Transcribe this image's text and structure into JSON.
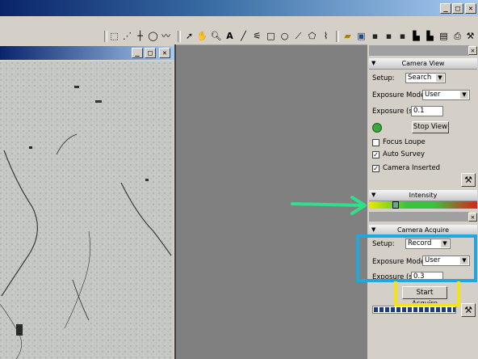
{
  "toolbar": {
    "icons": [
      "marquee-select-icon",
      "line-select-icon",
      "crosshair-icon",
      "lasso-icon",
      "freehand-icon",
      "arrow-pointer-icon",
      "hand-pan-icon",
      "zoom-icon",
      "text-tool-icon",
      "line-tool-icon",
      "wand-icon",
      "rectangle-tool-icon",
      "oval-tool-icon",
      "eyedropper-icon",
      "polygon-tool-icon",
      "script-icon",
      "open-folder-icon",
      "new-image-icon",
      "save-icon",
      "save-as-icon",
      "save-all-icon",
      "histogram-icon",
      "profile-icon",
      "stats-icon",
      "print-icon",
      "tools-icon"
    ]
  },
  "camera_view": {
    "title": "Camera View",
    "setup_label": "Setup:",
    "setup_value": "Search",
    "exposure_mode_label": "Exposure Mode:",
    "exposure_mode_value": "User",
    "exposure_label": "Exposure (s)",
    "exposure_value": "0.1",
    "stop_view_label": "Stop View",
    "focus_loupe_label": "Focus Loupe",
    "focus_loupe_checked": false,
    "auto_survey_label": "Auto Survey",
    "auto_survey_checked": true,
    "camera_inserted_label": "Camera Inserted",
    "camera_inserted_checked": true
  },
  "intensity": {
    "title": "Intensity",
    "level": 0.22
  },
  "camera_acquire": {
    "title": "Camera Acquire",
    "setup_label": "Setup:",
    "setup_value": "Record",
    "exposure_mode_label": "Exposure Mode:",
    "exposure_mode_value": "User",
    "exposure_label": "Exposure (s)",
    "exposure_value": "0.3",
    "start_acquire_label": "Start Acquire"
  },
  "colors": {
    "annotation_green": "#2ee08a",
    "annotation_blue": "#1fa8e0",
    "annotation_yellow": "#f2e21c",
    "status_led": "#3aa83a"
  }
}
